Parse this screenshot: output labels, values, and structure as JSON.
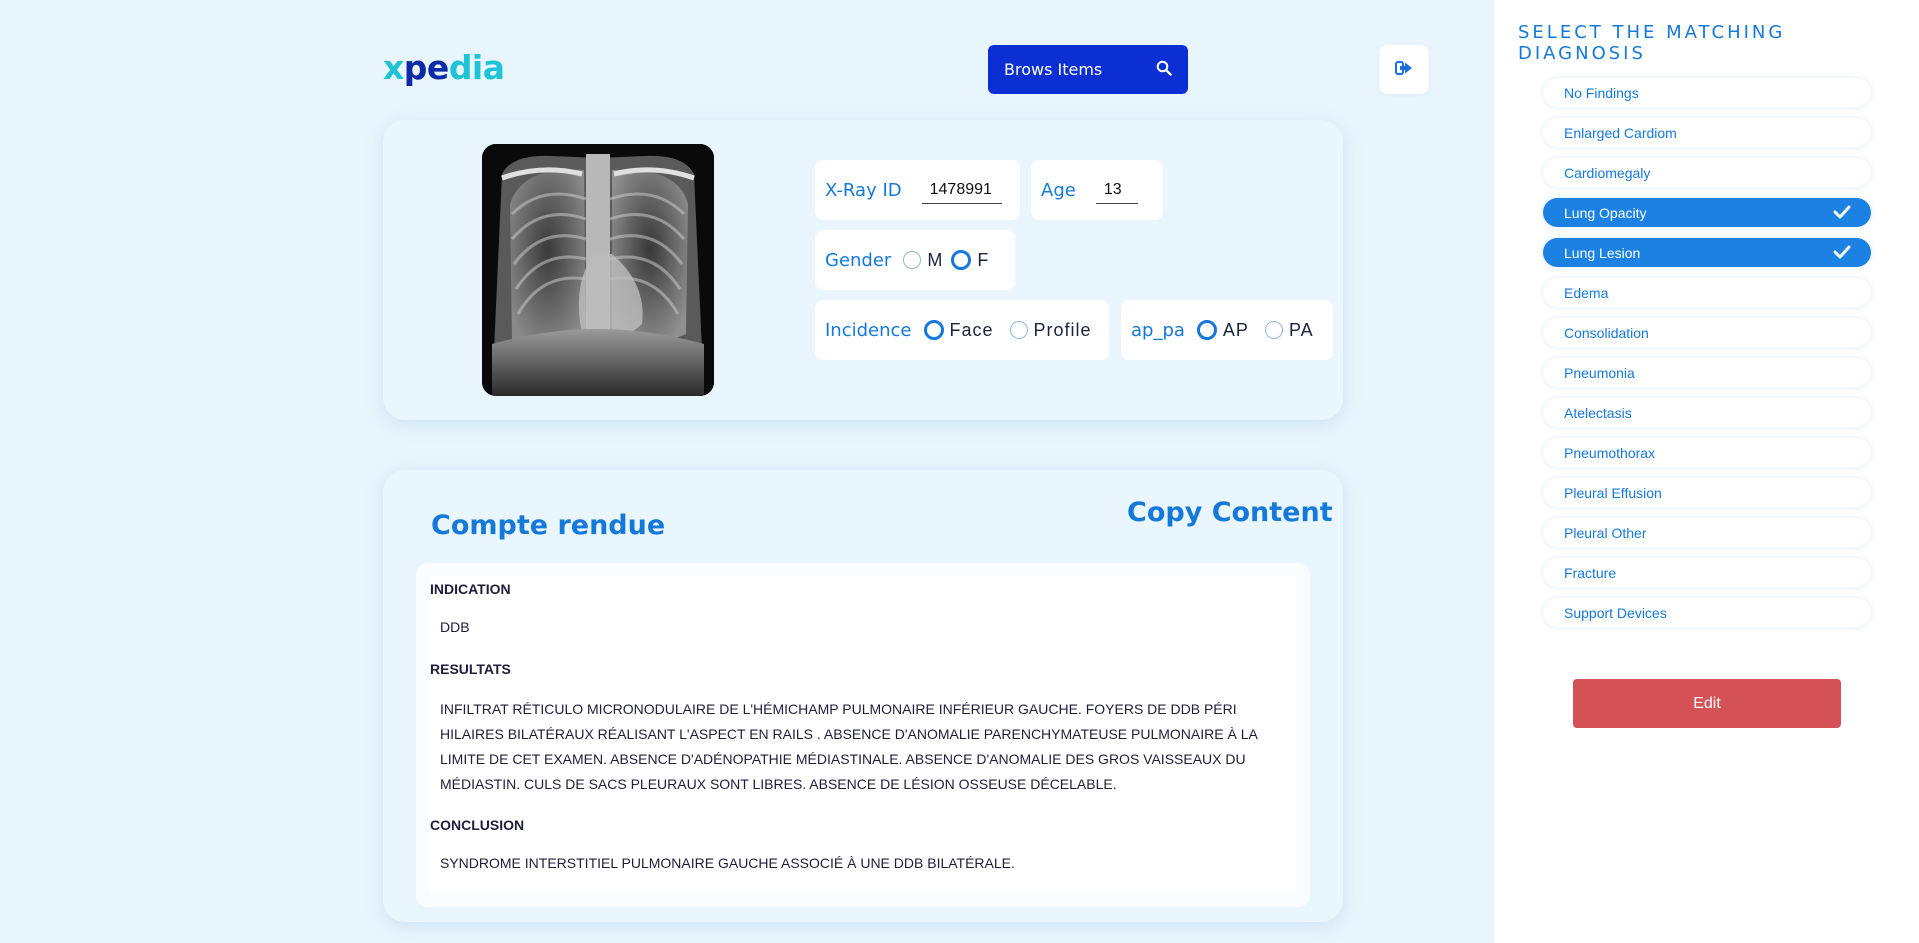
{
  "logo": {
    "part1": "x",
    "part2": "pe",
    "part3": "dia"
  },
  "header": {
    "browse_label": "Brows Items",
    "browse_icon": "search-icon",
    "logout_icon": "logout-icon"
  },
  "patient": {
    "xray_id_label": "X-Ray ID",
    "xray_id_value": "1478991",
    "age_label": "Age",
    "age_value": "13",
    "gender_label": "Gender",
    "gender_options": [
      "M",
      "F"
    ],
    "gender_selected": "F",
    "incidence_label": "Incidence",
    "incidence_options": [
      "Face",
      "Profile"
    ],
    "incidence_selected": "Face",
    "appa_label": "ap_pa",
    "appa_options": [
      "AP",
      "PA"
    ],
    "appa_selected": "AP"
  },
  "report": {
    "title": "Compte rendue",
    "copy_label": "Copy Content",
    "indication_heading": "INDICATION",
    "indication_text": "DDB",
    "resultats_heading": "RESULTATS",
    "resultats_text": "INFILTRAT RÉTICULO MICRONODULAIRE DE L'HÉMICHAMP PULMONAIRE INFÉRIEUR GAUCHE. FOYERS DE DDB PÉRI HILAIRES BILATÉRAUX RÉALISANT L'ASPECT EN RAILS . ABSENCE D'ANOMALIE PARENCHYMATEUSE PULMONAIRE À LA LIMITE DE CET EXAMEN. ABSENCE D'ADÉNOPATHIE MÉDIASTINALE. ABSENCE D'ANOMALIE DES GROS VAISSEAUX DU MÉDIASTIN. CULS DE SACS PLEURAUX SONT LIBRES. ABSENCE DE LÉSION OSSEUSE DÉCELABLE.",
    "conclusion_heading": "CONCLUSION",
    "conclusion_text": "SYNDROME INTERSTITIEL PULMONAIRE GAUCHE ASSOCIÉ À UNE DDB BILATÉRALE."
  },
  "diagnosis": {
    "title": "SELECT THE MATCHING DIAGNOSIS",
    "items": [
      {
        "label": "No Findings",
        "selected": false
      },
      {
        "label": "Enlarged Cardiom",
        "selected": false
      },
      {
        "label": "Cardiomegaly",
        "selected": false
      },
      {
        "label": "Lung Opacity",
        "selected": true
      },
      {
        "label": "Lung Lesion",
        "selected": true
      },
      {
        "label": "Edema",
        "selected": false
      },
      {
        "label": "Consolidation",
        "selected": false
      },
      {
        "label": "Pneumonia",
        "selected": false
      },
      {
        "label": "Atelectasis",
        "selected": false
      },
      {
        "label": "Pneumothorax",
        "selected": false
      },
      {
        "label": "Pleural Effusion",
        "selected": false
      },
      {
        "label": "Pleural Other",
        "selected": false
      },
      {
        "label": "Fracture",
        "selected": false
      },
      {
        "label": "Support Devices",
        "selected": false
      }
    ],
    "edit_label": "Edit"
  },
  "colors": {
    "accent": "#1579db",
    "brand": "#0b2fd3",
    "selected": "#1b82e4",
    "danger": "#d45155"
  }
}
